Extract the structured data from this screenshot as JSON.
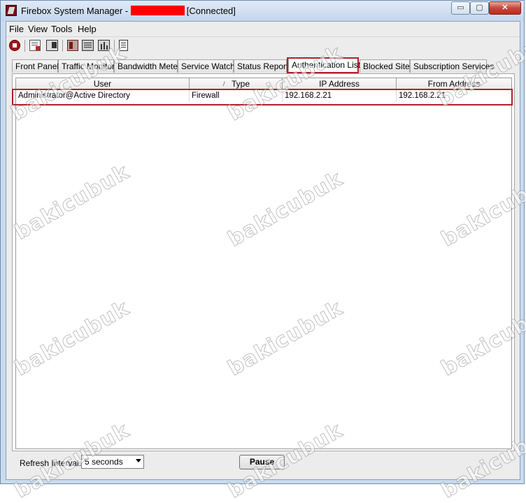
{
  "window": {
    "title_prefix": "Firebox System Manager - ",
    "title_suffix": "[Connected]",
    "min_glyph": "▭",
    "max_glyph": "▢",
    "close_glyph": "✕"
  },
  "menu": [
    "File",
    "View",
    "Tools",
    "Help"
  ],
  "toolbar": {
    "icons": [
      "stop-icon",
      "report-icon",
      "policy-icon",
      "hostwatch-icon",
      "log-icon",
      "performance-icon",
      "communication-log-icon"
    ]
  },
  "tabs": [
    {
      "label": "Front Panel",
      "active": false
    },
    {
      "label": "Traffic Monitor",
      "active": false
    },
    {
      "label": "Bandwidth Meter",
      "active": false
    },
    {
      "label": "Service Watch",
      "active": false
    },
    {
      "label": "Status Report",
      "active": false
    },
    {
      "label": "Authentication List",
      "active": true
    },
    {
      "label": "Blocked Sites",
      "active": false
    },
    {
      "label": "Subscription Services",
      "active": false
    }
  ],
  "table": {
    "columns": [
      "User",
      "Type",
      "IP Address",
      "From Address"
    ],
    "sort_indicator": "/",
    "rows": [
      [
        "Administrator@Active Directory",
        "Firewall",
        "192.168.2.21",
        "192.168.2.21"
      ]
    ]
  },
  "footer": {
    "refresh_label": "Refresh Interval:",
    "refresh_value": "5 seconds",
    "pause_label": "Pause"
  },
  "watermark": "bakicubuk",
  "colors": {
    "highlight": "#b0202d",
    "redaction": "#ff0000"
  }
}
